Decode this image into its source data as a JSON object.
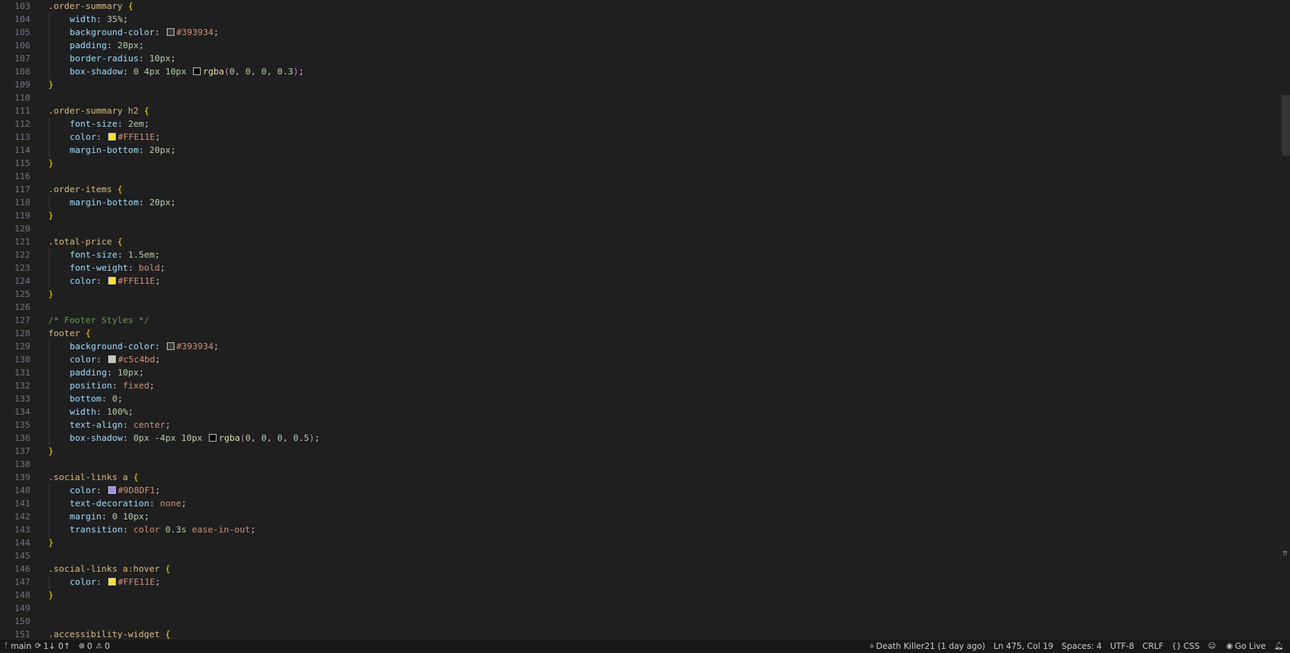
{
  "code_lines": [
    {
      "n": "103",
      "indent": false,
      "tokens": [
        {
          "t": ".order-summary",
          "c": "sel"
        },
        {
          "t": " ",
          "c": "pn"
        },
        {
          "t": "{",
          "c": "br1"
        }
      ]
    },
    {
      "n": "104",
      "indent": true,
      "tokens": [
        {
          "t": "width",
          "c": "prop"
        },
        {
          "t": ": ",
          "c": "pn"
        },
        {
          "t": "35%",
          "c": "num"
        },
        {
          "t": ";",
          "c": "pn"
        }
      ]
    },
    {
      "n": "105",
      "indent": true,
      "tokens": [
        {
          "t": "background-color",
          "c": "prop"
        },
        {
          "t": ": ",
          "c": "pn"
        },
        {
          "t": "",
          "c": "swatch",
          "color": "#393934"
        },
        {
          "t": "#393934",
          "c": "kw"
        },
        {
          "t": ";",
          "c": "pn"
        }
      ]
    },
    {
      "n": "106",
      "indent": true,
      "tokens": [
        {
          "t": "padding",
          "c": "prop"
        },
        {
          "t": ": ",
          "c": "pn"
        },
        {
          "t": "20px",
          "c": "num"
        },
        {
          "t": ";",
          "c": "pn"
        }
      ]
    },
    {
      "n": "107",
      "indent": true,
      "tokens": [
        {
          "t": "border-radius",
          "c": "prop"
        },
        {
          "t": ": ",
          "c": "pn"
        },
        {
          "t": "10px",
          "c": "num"
        },
        {
          "t": ";",
          "c": "pn"
        }
      ]
    },
    {
      "n": "108",
      "indent": true,
      "tokens": [
        {
          "t": "box-shadow",
          "c": "prop"
        },
        {
          "t": ": ",
          "c": "pn"
        },
        {
          "t": "0 4px 10px",
          "c": "num"
        },
        {
          "t": " ",
          "c": "pn"
        },
        {
          "t": "",
          "c": "swatch",
          "color": "#000000"
        },
        {
          "t": "rgba",
          "c": "fn"
        },
        {
          "t": "(",
          "c": "br2"
        },
        {
          "t": "0, 0, 0, 0.3",
          "c": "num"
        },
        {
          "t": ")",
          "c": "br2"
        },
        {
          "t": ";",
          "c": "pn"
        }
      ]
    },
    {
      "n": "109",
      "indent": false,
      "tokens": [
        {
          "t": "}",
          "c": "br1"
        }
      ]
    },
    {
      "n": "110",
      "indent": false,
      "tokens": []
    },
    {
      "n": "111",
      "indent": false,
      "tokens": [
        {
          "t": ".order-summary h2",
          "c": "sel"
        },
        {
          "t": " ",
          "c": "pn"
        },
        {
          "t": "{",
          "c": "br1"
        }
      ]
    },
    {
      "n": "112",
      "indent": true,
      "tokens": [
        {
          "t": "font-size",
          "c": "prop"
        },
        {
          "t": ": ",
          "c": "pn"
        },
        {
          "t": "2em",
          "c": "num"
        },
        {
          "t": ";",
          "c": "pn"
        }
      ]
    },
    {
      "n": "113",
      "indent": true,
      "tokens": [
        {
          "t": "color",
          "c": "prop"
        },
        {
          "t": ": ",
          "c": "pn"
        },
        {
          "t": "",
          "c": "swatch",
          "color": "#FFE11E"
        },
        {
          "t": "#FFE11E",
          "c": "kw"
        },
        {
          "t": ";",
          "c": "pn"
        }
      ]
    },
    {
      "n": "114",
      "indent": true,
      "tokens": [
        {
          "t": "margin-bottom",
          "c": "prop"
        },
        {
          "t": ": ",
          "c": "pn"
        },
        {
          "t": "20px",
          "c": "num"
        },
        {
          "t": ";",
          "c": "pn"
        }
      ]
    },
    {
      "n": "115",
      "indent": false,
      "tokens": [
        {
          "t": "}",
          "c": "br1"
        }
      ]
    },
    {
      "n": "116",
      "indent": false,
      "tokens": []
    },
    {
      "n": "117",
      "indent": false,
      "tokens": [
        {
          "t": ".order-items",
          "c": "sel"
        },
        {
          "t": " ",
          "c": "pn"
        },
        {
          "t": "{",
          "c": "br1"
        }
      ]
    },
    {
      "n": "118",
      "indent": true,
      "tokens": [
        {
          "t": "margin-bottom",
          "c": "prop"
        },
        {
          "t": ": ",
          "c": "pn"
        },
        {
          "t": "20px",
          "c": "num"
        },
        {
          "t": ";",
          "c": "pn"
        }
      ]
    },
    {
      "n": "119",
      "indent": false,
      "tokens": [
        {
          "t": "}",
          "c": "br1"
        }
      ]
    },
    {
      "n": "120",
      "indent": false,
      "tokens": []
    },
    {
      "n": "121",
      "indent": false,
      "tokens": [
        {
          "t": ".total-price",
          "c": "sel"
        },
        {
          "t": " ",
          "c": "pn"
        },
        {
          "t": "{",
          "c": "br1"
        }
      ]
    },
    {
      "n": "122",
      "indent": true,
      "tokens": [
        {
          "t": "font-size",
          "c": "prop"
        },
        {
          "t": ": ",
          "c": "pn"
        },
        {
          "t": "1.5em",
          "c": "num"
        },
        {
          "t": ";",
          "c": "pn"
        }
      ]
    },
    {
      "n": "123",
      "indent": true,
      "tokens": [
        {
          "t": "font-weight",
          "c": "prop"
        },
        {
          "t": ": ",
          "c": "pn"
        },
        {
          "t": "bold",
          "c": "kw"
        },
        {
          "t": ";",
          "c": "pn"
        }
      ]
    },
    {
      "n": "124",
      "indent": true,
      "tokens": [
        {
          "t": "color",
          "c": "prop"
        },
        {
          "t": ": ",
          "c": "pn"
        },
        {
          "t": "",
          "c": "swatch",
          "color": "#FFE11E"
        },
        {
          "t": "#FFE11E",
          "c": "kw"
        },
        {
          "t": ";",
          "c": "pn"
        }
      ]
    },
    {
      "n": "125",
      "indent": false,
      "tokens": [
        {
          "t": "}",
          "c": "br1"
        }
      ]
    },
    {
      "n": "126",
      "indent": false,
      "tokens": []
    },
    {
      "n": "127",
      "indent": false,
      "tokens": [
        {
          "t": "/* Footer Styles */",
          "c": "cmt"
        }
      ]
    },
    {
      "n": "128",
      "indent": false,
      "tokens": [
        {
          "t": "footer",
          "c": "sel"
        },
        {
          "t": " ",
          "c": "pn"
        },
        {
          "t": "{",
          "c": "br1"
        }
      ]
    },
    {
      "n": "129",
      "indent": true,
      "tokens": [
        {
          "t": "background-color",
          "c": "prop"
        },
        {
          "t": ": ",
          "c": "pn"
        },
        {
          "t": "",
          "c": "swatch",
          "color": "#393934"
        },
        {
          "t": "#393934",
          "c": "kw"
        },
        {
          "t": ";",
          "c": "pn"
        }
      ]
    },
    {
      "n": "130",
      "indent": true,
      "tokens": [
        {
          "t": "color",
          "c": "prop"
        },
        {
          "t": ": ",
          "c": "pn"
        },
        {
          "t": "",
          "c": "swatch",
          "color": "#c5c4bd"
        },
        {
          "t": "#c5c4bd",
          "c": "kw"
        },
        {
          "t": ";",
          "c": "pn"
        }
      ]
    },
    {
      "n": "131",
      "indent": true,
      "tokens": [
        {
          "t": "padding",
          "c": "prop"
        },
        {
          "t": ": ",
          "c": "pn"
        },
        {
          "t": "10px",
          "c": "num"
        },
        {
          "t": ";",
          "c": "pn"
        }
      ]
    },
    {
      "n": "132",
      "indent": true,
      "tokens": [
        {
          "t": "position",
          "c": "prop"
        },
        {
          "t": ": ",
          "c": "pn"
        },
        {
          "t": "fixed",
          "c": "kw"
        },
        {
          "t": ";",
          "c": "pn"
        }
      ]
    },
    {
      "n": "133",
      "indent": true,
      "tokens": [
        {
          "t": "bottom",
          "c": "prop"
        },
        {
          "t": ": ",
          "c": "pn"
        },
        {
          "t": "0",
          "c": "num"
        },
        {
          "t": ";",
          "c": "pn"
        }
      ]
    },
    {
      "n": "134",
      "indent": true,
      "tokens": [
        {
          "t": "width",
          "c": "prop"
        },
        {
          "t": ": ",
          "c": "pn"
        },
        {
          "t": "100%",
          "c": "num"
        },
        {
          "t": ";",
          "c": "pn"
        }
      ]
    },
    {
      "n": "135",
      "indent": true,
      "tokens": [
        {
          "t": "text-align",
          "c": "prop"
        },
        {
          "t": ": ",
          "c": "pn"
        },
        {
          "t": "center",
          "c": "kw"
        },
        {
          "t": ";",
          "c": "pn"
        }
      ]
    },
    {
      "n": "136",
      "indent": true,
      "tokens": [
        {
          "t": "box-shadow",
          "c": "prop"
        },
        {
          "t": ": ",
          "c": "pn"
        },
        {
          "t": "0px -4px 10px",
          "c": "num"
        },
        {
          "t": " ",
          "c": "pn"
        },
        {
          "t": "",
          "c": "swatch",
          "color": "#000000"
        },
        {
          "t": "rgba",
          "c": "fn"
        },
        {
          "t": "(",
          "c": "br2"
        },
        {
          "t": "0, 0, 0, 0.5",
          "c": "num"
        },
        {
          "t": ")",
          "c": "br2"
        },
        {
          "t": ";",
          "c": "pn"
        }
      ]
    },
    {
      "n": "137",
      "indent": false,
      "tokens": [
        {
          "t": "}",
          "c": "br1"
        }
      ]
    },
    {
      "n": "138",
      "indent": false,
      "tokens": []
    },
    {
      "n": "139",
      "indent": false,
      "tokens": [
        {
          "t": ".social-links a",
          "c": "sel"
        },
        {
          "t": " ",
          "c": "pn"
        },
        {
          "t": "{",
          "c": "br1"
        }
      ]
    },
    {
      "n": "140",
      "indent": true,
      "tokens": [
        {
          "t": "color",
          "c": "prop"
        },
        {
          "t": ": ",
          "c": "pn"
        },
        {
          "t": "",
          "c": "swatch",
          "color": "#9D8DF1"
        },
        {
          "t": "#9D8DF1",
          "c": "kw"
        },
        {
          "t": ";",
          "c": "pn"
        }
      ]
    },
    {
      "n": "141",
      "indent": true,
      "tokens": [
        {
          "t": "text-decoration",
          "c": "prop"
        },
        {
          "t": ": ",
          "c": "pn"
        },
        {
          "t": "none",
          "c": "kw"
        },
        {
          "t": ";",
          "c": "pn"
        }
      ]
    },
    {
      "n": "142",
      "indent": true,
      "tokens": [
        {
          "t": "margin",
          "c": "prop"
        },
        {
          "t": ": ",
          "c": "pn"
        },
        {
          "t": "0 10px",
          "c": "num"
        },
        {
          "t": ";",
          "c": "pn"
        }
      ]
    },
    {
      "n": "143",
      "indent": true,
      "tokens": [
        {
          "t": "transition",
          "c": "prop"
        },
        {
          "t": ": ",
          "c": "pn"
        },
        {
          "t": "color",
          "c": "kw"
        },
        {
          "t": " ",
          "c": "pn"
        },
        {
          "t": "0.3s",
          "c": "num"
        },
        {
          "t": " ",
          "c": "pn"
        },
        {
          "t": "ease-in-out",
          "c": "kw"
        },
        {
          "t": ";",
          "c": "pn"
        }
      ]
    },
    {
      "n": "144",
      "indent": false,
      "tokens": [
        {
          "t": "}",
          "c": "br1"
        }
      ]
    },
    {
      "n": "145",
      "indent": false,
      "tokens": []
    },
    {
      "n": "146",
      "indent": false,
      "tokens": [
        {
          "t": ".social-links a:hover",
          "c": "sel"
        },
        {
          "t": " ",
          "c": "pn"
        },
        {
          "t": "{",
          "c": "br1"
        }
      ]
    },
    {
      "n": "147",
      "indent": true,
      "tokens": [
        {
          "t": "color",
          "c": "prop"
        },
        {
          "t": ": ",
          "c": "pn"
        },
        {
          "t": "",
          "c": "swatch",
          "color": "#FFE11E"
        },
        {
          "t": "#FFE11E",
          "c": "kw"
        },
        {
          "t": ";",
          "c": "pn"
        }
      ]
    },
    {
      "n": "148",
      "indent": false,
      "tokens": [
        {
          "t": "}",
          "c": "br1"
        }
      ]
    },
    {
      "n": "149",
      "indent": false,
      "tokens": []
    },
    {
      "n": "150",
      "indent": false,
      "tokens": []
    },
    {
      "n": "151",
      "indent": false,
      "tokens": [
        {
          "t": ".accessibility-widget",
          "c": "sel"
        },
        {
          "t": " ",
          "c": "pn"
        },
        {
          "t": "{",
          "c": "br1"
        }
      ]
    }
  ],
  "statusbar": {
    "branch": "main",
    "sync": "1↓ 0↑",
    "errors": "0",
    "warnings": "0",
    "blame": "Death Killer21 (1 day ago)",
    "cursor": "Ln 475, Col 19",
    "spaces": "Spaces: 4",
    "encoding": "UTF-8",
    "eol": "CRLF",
    "language": "CSS",
    "golive": "Go Live"
  },
  "icons": {
    "branch": "git-branch-icon",
    "sync": "sync-icon",
    "error": "error-icon",
    "warning": "warning-icon",
    "blame": "git-commit-icon",
    "language": "braces-icon",
    "copilot": "copilot-icon",
    "golive": "broadcast-icon",
    "bell": "bell-icon"
  },
  "colors": {
    "editor_bg": "#1f1f1f",
    "statusbar_bg": "#181818"
  }
}
